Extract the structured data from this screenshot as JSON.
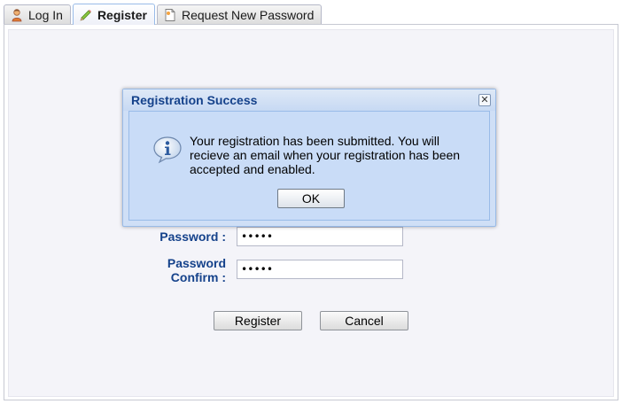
{
  "tabs": [
    {
      "label": "Log In",
      "icon": "user-icon"
    },
    {
      "label": "Register",
      "icon": "pencil-icon",
      "active": true
    },
    {
      "label": "Request New Password",
      "icon": "document-icon"
    }
  ],
  "form": {
    "password_label": "Password :",
    "password_value": "•••••",
    "password_confirm_label_line1": "Password",
    "password_confirm_label_line2": "Confirm :",
    "password_confirm_value": "•••••",
    "register_label": "Register",
    "cancel_label": "Cancel"
  },
  "dialog": {
    "title": "Registration Success",
    "message": "Your registration has been submitted. You will recieve an email when your registration has been accepted and enabled.",
    "ok_label": "OK",
    "close_glyph": "✕",
    "icon": "info-icon"
  },
  "colors": {
    "label_blue": "#15428b",
    "dialog_bg": "#c9dcf7",
    "panel_bg": "#f4f4f9"
  }
}
